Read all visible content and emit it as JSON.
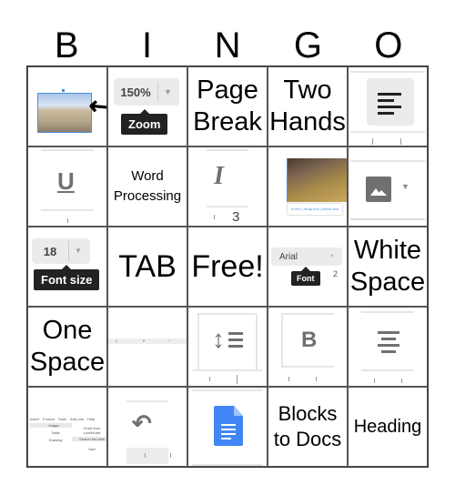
{
  "header": {
    "letters": [
      "B",
      "I",
      "N",
      "G",
      "O"
    ]
  },
  "cells": {
    "r0c0": {
      "desc": "image with selection handles and cursor arrow"
    },
    "r0c1": {
      "zoom_value": "150%",
      "tooltip": "Zoom"
    },
    "r0c2": {
      "line1": "Page",
      "line2": "Break"
    },
    "r0c3": {
      "line1": "Two",
      "line2": "Hands"
    },
    "r0c4": {
      "icon": "align-left-icon"
    },
    "r1c0": {
      "icon": "underline-icon"
    },
    "r1c1": {
      "line1": "Word",
      "line2": "Processing"
    },
    "r1c2": {
      "icon": "italic-icon",
      "ruler_number": "3"
    },
    "r1c3": {
      "image_options": "In line | Wrap text | Break text"
    },
    "r1c4": {
      "icon": "insert-image-icon"
    },
    "r2c0": {
      "font_size_value": "18",
      "tooltip": "Font size"
    },
    "r2c1": {
      "text": "TAB"
    },
    "r2c2": {
      "text": "Free!"
    },
    "r2c3": {
      "font_value": "Arial",
      "tooltip": "Font",
      "ruler_number": "2"
    },
    "r2c4": {
      "line1": "White",
      "line2": "Space"
    },
    "r3c0": {
      "line1": "One",
      "line2": "Space"
    },
    "r3c1": {
      "desc": "ruler",
      "ruler_number1": "6",
      "ruler_number2": "7"
    },
    "r3c2": {
      "icon": "line-spacing-icon"
    },
    "r3c3": {
      "icon": "bold-icon",
      "letter": "B"
    },
    "r3c4": {
      "icon": "align-center-icon"
    },
    "r4c0": {
      "menu": [
        "Insert",
        "Format",
        "Tools",
        "Add-ons",
        "Help"
      ],
      "items": [
        "Image",
        "Table",
        "Drawing"
      ],
      "submenu": [
        "Chart from Lucidchart",
        "Search the web",
        "Size"
      ]
    },
    "r4c1": {
      "icon": "undo-icon"
    },
    "r4c2": {
      "icon": "google-docs-icon"
    },
    "r4c3": {
      "line1": "Blocks",
      "line2": "to Docs"
    },
    "r4c4": {
      "text": "Heading"
    }
  },
  "colors": {
    "docs_blue": "#4285f4",
    "icon_grey": "#707070",
    "tooltip_bg": "#222222",
    "selection_blue": "#4a90e2"
  }
}
